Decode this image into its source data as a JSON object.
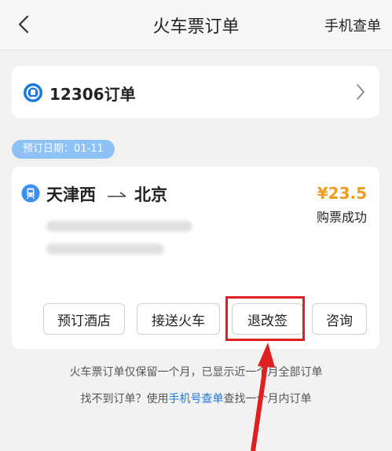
{
  "header": {
    "title": "火车票订单",
    "right_action": "手机查单"
  },
  "entry_12306": {
    "label": "12306订单"
  },
  "booking_date": "预订日期：01-11",
  "order": {
    "from_station": "天津西",
    "to_station": "北京",
    "price": "¥23.5",
    "status": "购票成功",
    "actions": [
      "预订酒店",
      "接送火车",
      "退改签",
      "咨询"
    ]
  },
  "footer": {
    "line1": "火车票订单仅保留一个月，已显示近一个月全部订单",
    "line2_prefix": "找不到订单？使用",
    "line2_link": "手机号查单",
    "line2_suffix": "查找一个月内订单"
  },
  "colors": {
    "accent_blue": "#1a7ae0",
    "date_pill": "#8ec2f7",
    "price_orange": "#f39a1f",
    "annotation_red": "#e02020"
  },
  "icons": [
    "back-arrow-icon",
    "logo-12306-icon",
    "chevron-right-icon",
    "train-icon",
    "route-arrow-icon"
  ]
}
